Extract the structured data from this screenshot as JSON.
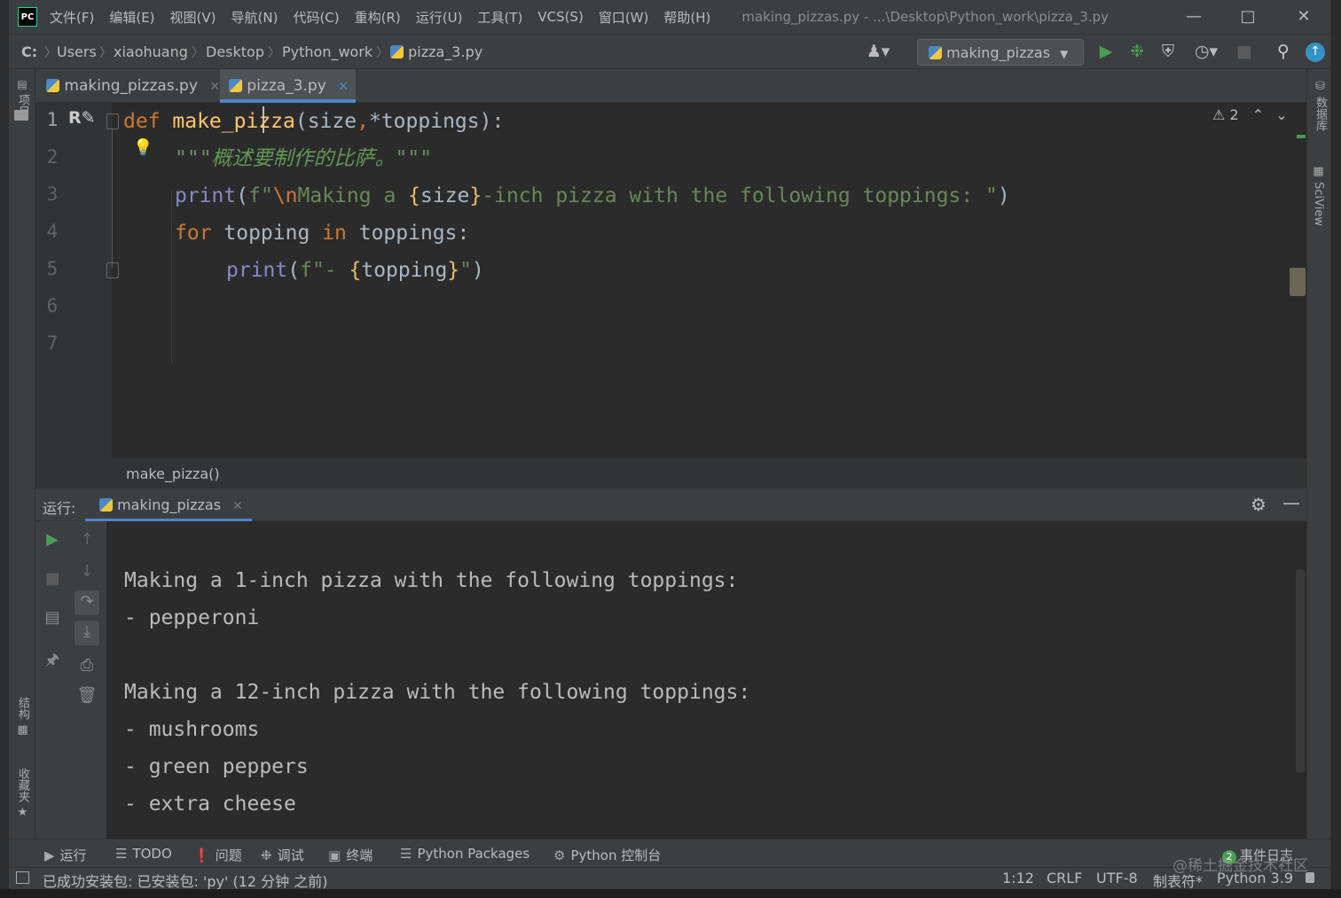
{
  "menu": {
    "items": [
      "文件(F)",
      "编辑(E)",
      "视图(V)",
      "导航(N)",
      "代码(C)",
      "重构(R)",
      "运行(U)",
      "工具(T)",
      "VCS(S)",
      "窗口(W)",
      "帮助(H)"
    ],
    "window_title": "making_pizzas.py - ...\\Desktop\\Python_work\\pizza_3.py"
  },
  "breadcrumbs": [
    "C:",
    "Users",
    "xiaohuang",
    "Desktop",
    "Python_work",
    "pizza_3.py"
  ],
  "run_config": "making_pizzas",
  "left_strip": {
    "project": "项目",
    "structure": "结构",
    "favorites": "收藏夹"
  },
  "right_strip": {
    "database": "数据库",
    "sciview": "SciView"
  },
  "tabs": [
    {
      "label": "making_pizzas.py",
      "active": false
    },
    {
      "label": "pizza_3.py",
      "active": true
    }
  ],
  "editor": {
    "line_numbers": [
      "1",
      "2",
      "3",
      "4",
      "5",
      "6",
      "7"
    ],
    "inspection_count": "2",
    "lines": [
      {
        "tokens": [
          [
            "kw",
            "def "
          ],
          [
            "fn",
            "make_pizza"
          ],
          [
            "pl",
            "(size"
          ],
          [
            "kw",
            ","
          ],
          [
            "pl",
            "*toppings):"
          ]
        ]
      },
      {
        "tokens": [
          [
            "doc",
            "\"\"\"概述要制作的比萨。\"\"\""
          ]
        ]
      },
      {
        "tokens": [
          [
            "bi",
            "print"
          ],
          [
            "pl",
            "("
          ],
          [
            "st",
            "f\""
          ],
          [
            "esc",
            "\\n"
          ],
          [
            "st",
            "Making a "
          ],
          [
            "br",
            "{"
          ],
          [
            "pl",
            "size"
          ],
          [
            "br",
            "}"
          ],
          [
            "st",
            "-inch pizza with the following toppings: \""
          ],
          [
            "pl",
            ")"
          ]
        ]
      },
      {
        "tokens": [
          [
            "kw",
            "for "
          ],
          [
            "pl",
            "topping "
          ],
          [
            "kw",
            "in "
          ],
          [
            "pl",
            "toppings:"
          ]
        ]
      },
      {
        "tokens": [
          [
            "bi",
            "print"
          ],
          [
            "pl",
            "("
          ],
          [
            "st",
            "f\"- "
          ],
          [
            "br",
            "{"
          ],
          [
            "pl",
            "topping"
          ],
          [
            "br",
            "}"
          ],
          [
            "st",
            "\""
          ],
          [
            "pl",
            ")"
          ]
        ]
      }
    ],
    "scope_crumb": "make_pizza()"
  },
  "run_panel": {
    "label": "运行:",
    "tab": "making_pizzas",
    "output": [
      "Making a 1-inch pizza with the following toppings:",
      "- pepperoni",
      "",
      "Making a 12-inch pizza with the following toppings:",
      "- mushrooms",
      "- green peppers",
      "- extra cheese"
    ]
  },
  "tool_windows": {
    "run": "运行",
    "todo": "TODO",
    "problems": "问题",
    "debug": "调试",
    "terminal": "终端",
    "packages": "Python Packages",
    "console": "Python 控制台",
    "event_log": "事件日志",
    "event_count": "2"
  },
  "status": {
    "message": "已成功安装包: 已安装包: 'py' (12 分钟 之前)",
    "position": "1:12",
    "line_sep": "CRLF",
    "encoding": "UTF-8",
    "indent": "制表符*",
    "interpreter": "Python 3.9"
  },
  "watermark": "@稀土掘金技术社区",
  "colors": {
    "accent_tab": "#4a88c7",
    "run_green": "#499c54",
    "keyword": "#cc7832",
    "function": "#ffc66d",
    "string": "#6a8759"
  }
}
